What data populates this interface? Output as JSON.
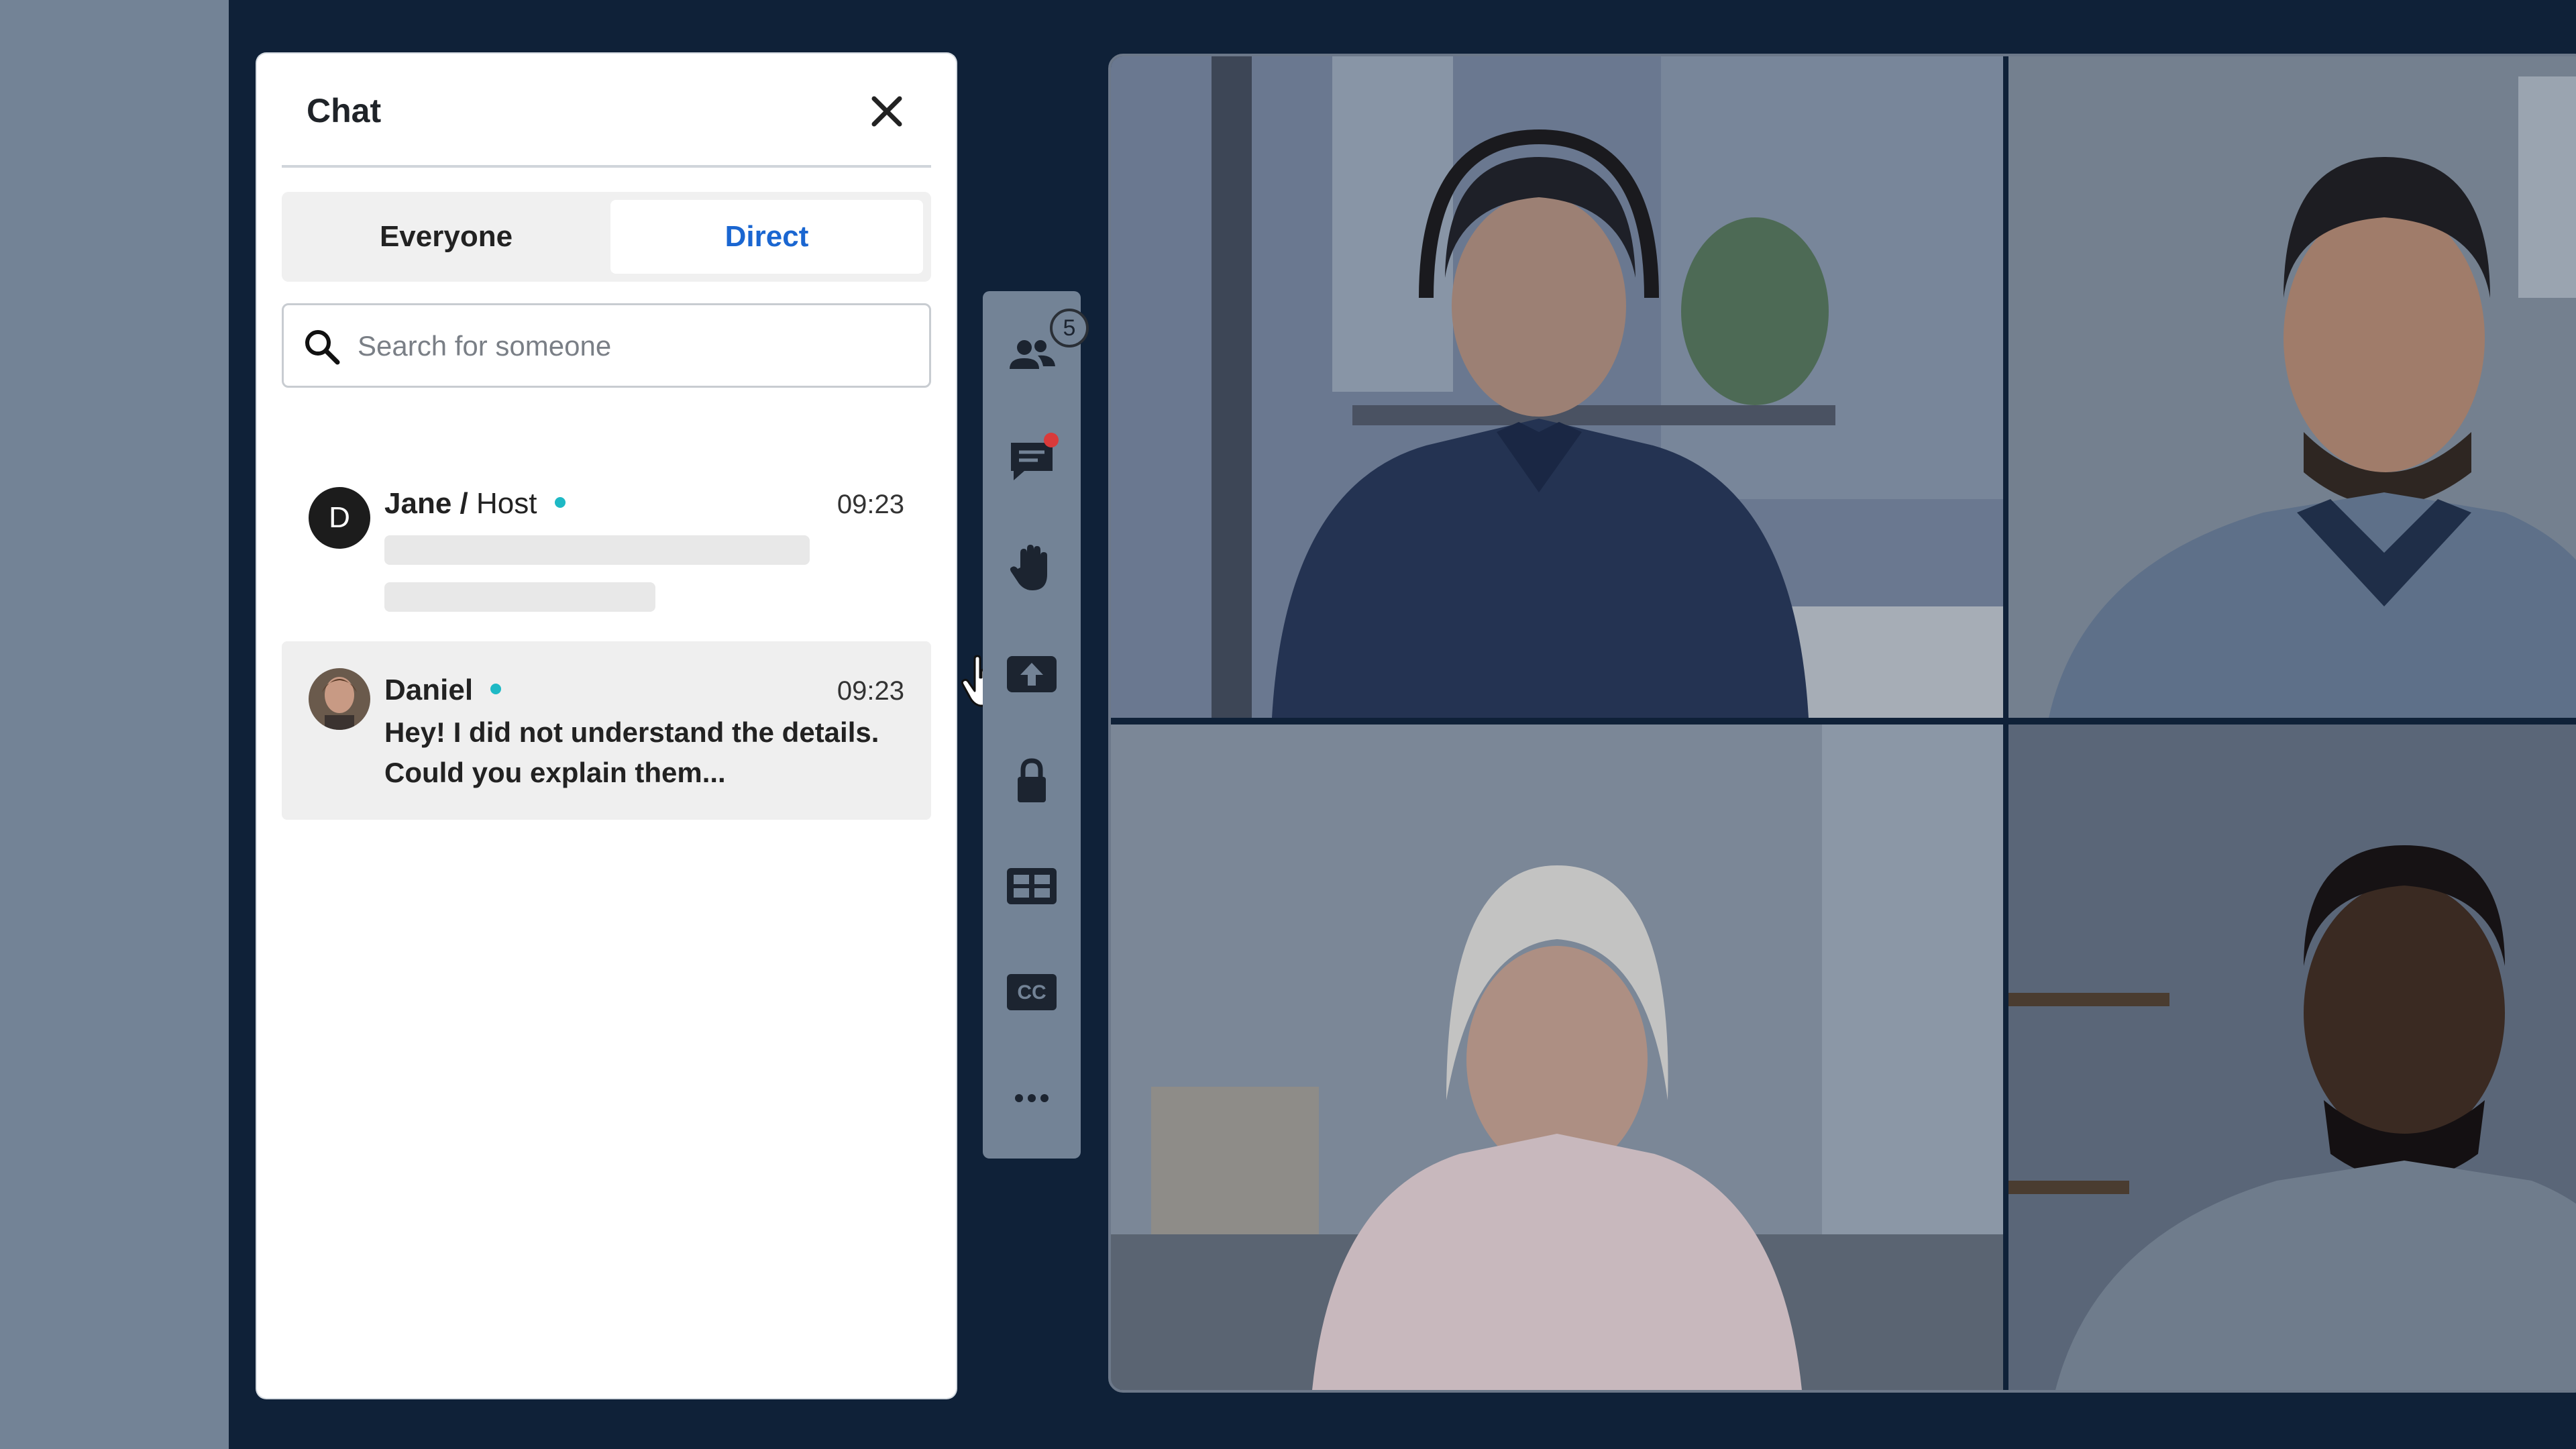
{
  "chat": {
    "title": "Chat",
    "close_icon": "close-icon",
    "tabs": [
      {
        "label": "Everyone",
        "active": false
      },
      {
        "label": "Direct",
        "active": true
      }
    ],
    "search": {
      "placeholder": "Search for someone"
    },
    "conversations": [
      {
        "avatar_letter": "D",
        "name": "Jane",
        "role_separator": "/",
        "role": "Host",
        "status": "online",
        "time": "09:23",
        "preview": ""
      },
      {
        "avatar": "person-photo",
        "name": "Daniel",
        "status": "online",
        "time": "09:23",
        "preview": "Hey! I did not understand the details. Could you explain them..."
      }
    ]
  },
  "toolbar": {
    "items": [
      {
        "icon": "participants-icon",
        "badge": "5"
      },
      {
        "icon": "chat-icon",
        "has_notification": true
      },
      {
        "icon": "raise-hand-icon"
      },
      {
        "icon": "share-screen-icon"
      },
      {
        "icon": "lock-icon"
      },
      {
        "icon": "layout-grid-icon"
      },
      {
        "icon": "closed-captions-icon",
        "label": "CC"
      },
      {
        "icon": "more-icon"
      }
    ]
  },
  "video_tiles": [
    {
      "participant": "woman-with-headset"
    },
    {
      "participant": "man-with-headset"
    },
    {
      "participant": "smiling-woman"
    },
    {
      "participant": "smiling-man"
    }
  ],
  "colors": {
    "background": "#0f2138",
    "accent": "#1a66d1",
    "online": "#1eb9c5",
    "notification": "#d93a3a"
  }
}
